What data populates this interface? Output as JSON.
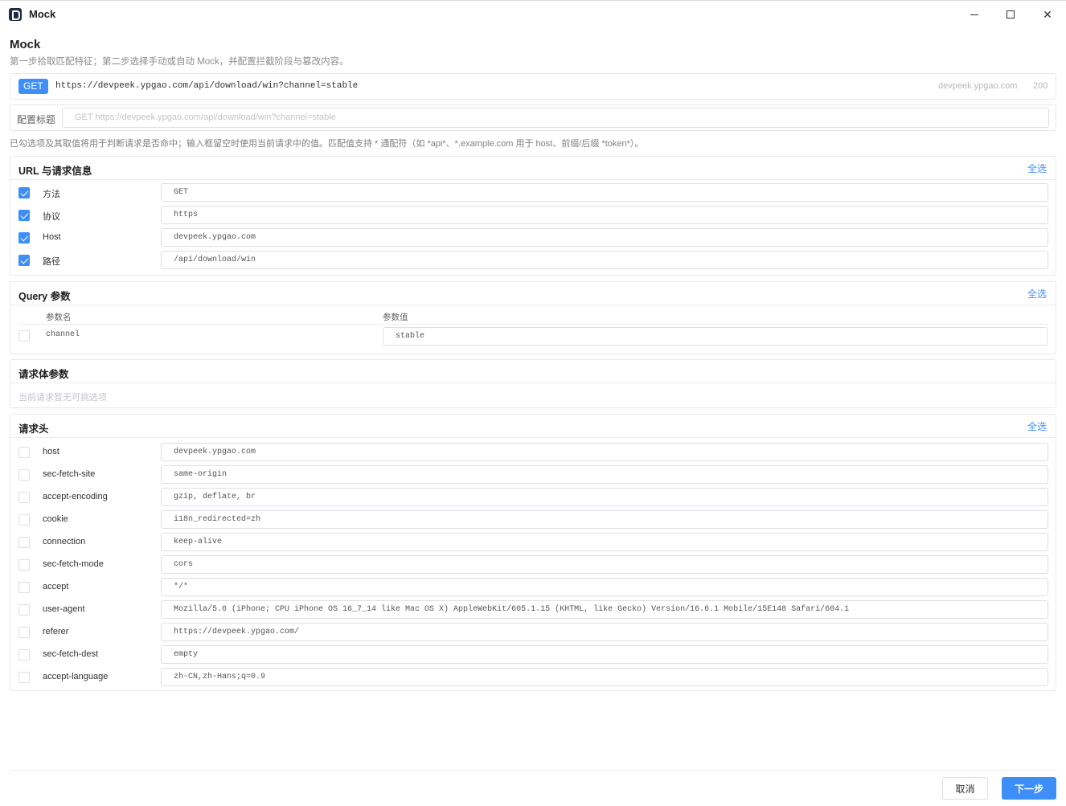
{
  "window": {
    "title": "Mock"
  },
  "page": {
    "title": "Mock",
    "subtitle": "第一步拾取匹配特征；第二步选择手动或自动 Mock，并配置拦截阶段与篡改内容。"
  },
  "request": {
    "method": "GET",
    "url": "https://devpeek.ypgao.com/api/download/win?channel=stable",
    "host": "devpeek.ypgao.com",
    "status": "200"
  },
  "config": {
    "label": "配置标题",
    "placeholder": "GET https://devpeek.ypgao.com/api/download/win?channel=stable"
  },
  "hint": "已勾选项及其取值将用于判断请求是否命中；输入框留空时使用当前请求中的值。匹配值支持 * 通配符（如 *api*、*.example.com 用于 host、前缀/后缀 *token*）。",
  "url_section": {
    "title": "URL 与请求信息",
    "select_all": "全选",
    "rows": [
      {
        "label": "方法",
        "value": "GET",
        "checked": true
      },
      {
        "label": "协议",
        "value": "https",
        "checked": true
      },
      {
        "label": "Host",
        "value": "devpeek.ypgao.com",
        "checked": true
      },
      {
        "label": "路径",
        "value": "/api/download/win",
        "checked": true
      }
    ]
  },
  "query_section": {
    "title": "Query 参数",
    "select_all": "全选",
    "col_name": "参数名",
    "col_value": "参数值",
    "rows": [
      {
        "name": "channel",
        "value": "stable",
        "checked": false
      }
    ]
  },
  "body_section": {
    "title": "请求体参数",
    "empty": "当前请求暂无可挑选项"
  },
  "headers_section": {
    "title": "请求头",
    "select_all": "全选",
    "rows": [
      {
        "label": "host",
        "value": "devpeek.ypgao.com",
        "checked": false
      },
      {
        "label": "sec-fetch-site",
        "value": "same-origin",
        "checked": false
      },
      {
        "label": "accept-encoding",
        "value": "gzip, deflate, br",
        "checked": false
      },
      {
        "label": "cookie",
        "value": "i18n_redirected=zh",
        "checked": false
      },
      {
        "label": "connection",
        "value": "keep-alive",
        "checked": false
      },
      {
        "label": "sec-fetch-mode",
        "value": "cors",
        "checked": false
      },
      {
        "label": "accept",
        "value": "*/*",
        "checked": false
      },
      {
        "label": "user-agent",
        "value": "Mozilla/5.0 (iPhone; CPU iPhone OS 16_7_14 like Mac OS X) AppleWebKit/605.1.15 (KHTML, like Gecko) Version/16.6.1 Mobile/15E148 Safari/604.1",
        "checked": false
      },
      {
        "label": "referer",
        "value": "https://devpeek.ypgao.com/",
        "checked": false
      },
      {
        "label": "sec-fetch-dest",
        "value": "empty",
        "checked": false
      },
      {
        "label": "accept-language",
        "value": "zh-CN,zh-Hans;q=0.9",
        "checked": false
      }
    ]
  },
  "footer": {
    "cancel": "取消",
    "next": "下一步"
  },
  "colors": {
    "accent": "#3d8ef7",
    "border": "#e8e8e8"
  }
}
